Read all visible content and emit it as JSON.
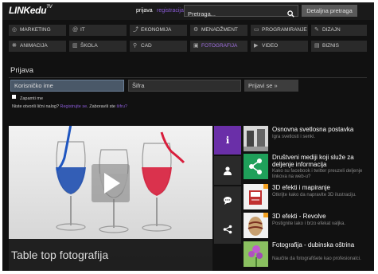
{
  "header": {
    "logo_main": "LINKedu",
    "logo_sup": "TV",
    "login_link": "prijava",
    "register_link": "registracija",
    "search_placeholder": "Pretraga...",
    "detail_search": "Detaljna pretraga"
  },
  "categories": [
    {
      "label": "MARKETING",
      "icon": "target-icon",
      "glyph": "◎",
      "active": false
    },
    {
      "label": "IT",
      "icon": "at-icon",
      "glyph": "@",
      "active": false
    },
    {
      "label": "EKONOMIJA",
      "icon": "chart-icon",
      "glyph": "⤴",
      "active": false
    },
    {
      "label": "MENADŽMENT",
      "icon": "gear-icon",
      "glyph": "⚙",
      "active": false
    },
    {
      "label": "PROGRAMIRANJE",
      "icon": "code-icon",
      "glyph": "▭",
      "active": false
    },
    {
      "label": "DIZAJN",
      "icon": "pen-icon",
      "glyph": "✎",
      "active": false
    },
    {
      "label": "ANIMACIJA",
      "icon": "animation-icon",
      "glyph": "❋",
      "active": false
    },
    {
      "label": "ŠKOLA",
      "icon": "school-icon",
      "glyph": "▥",
      "active": false
    },
    {
      "label": "CAD",
      "icon": "compass-icon",
      "glyph": "⚲",
      "active": false
    },
    {
      "label": "FOTOGRAFIJA",
      "icon": "camera-icon",
      "glyph": "▣",
      "active": true
    },
    {
      "label": "VIDEO",
      "icon": "video-icon",
      "glyph": "▶",
      "active": false
    },
    {
      "label": "BIZNIS",
      "icon": "briefcase-icon",
      "glyph": "▤",
      "active": false
    }
  ],
  "login": {
    "title": "Prijava",
    "username_placeholder": "Korisničko ime",
    "password_placeholder": "Šifra",
    "submit": "Prijavi se »",
    "remember": "Zapamti me",
    "no_account": "Niste otvorili lični nalog?",
    "register": "Registrujte se",
    "forgot_prefix": "Zaboravili ste",
    "forgot_link": "šifru?"
  },
  "hero": {
    "title": "Table top fotografija"
  },
  "articles": [
    {
      "title": "Osnovna svetlosna postavka",
      "desc": "Igra svetlosti i senki."
    },
    {
      "title": "Društveni mediji koji služe za deljenje informacija",
      "desc": "Kako su facebook i twitter preuzeli deljenje linkova na web-u?"
    },
    {
      "title": "3D efekti i mapiranje",
      "desc": "Otkrijte kako da napravite 3D ilustraciju."
    },
    {
      "title": "3D efekti - Revolve",
      "desc": "Postignite lako i brzo efekat valjka."
    },
    {
      "title": "Fotografija - dubinska oštrina",
      "desc": "Naučite da fotografišete kao profesionalci."
    }
  ],
  "colors": {
    "accent": "#6a2fa8",
    "share": "#1fa05a",
    "link": "#8a5bd6"
  }
}
